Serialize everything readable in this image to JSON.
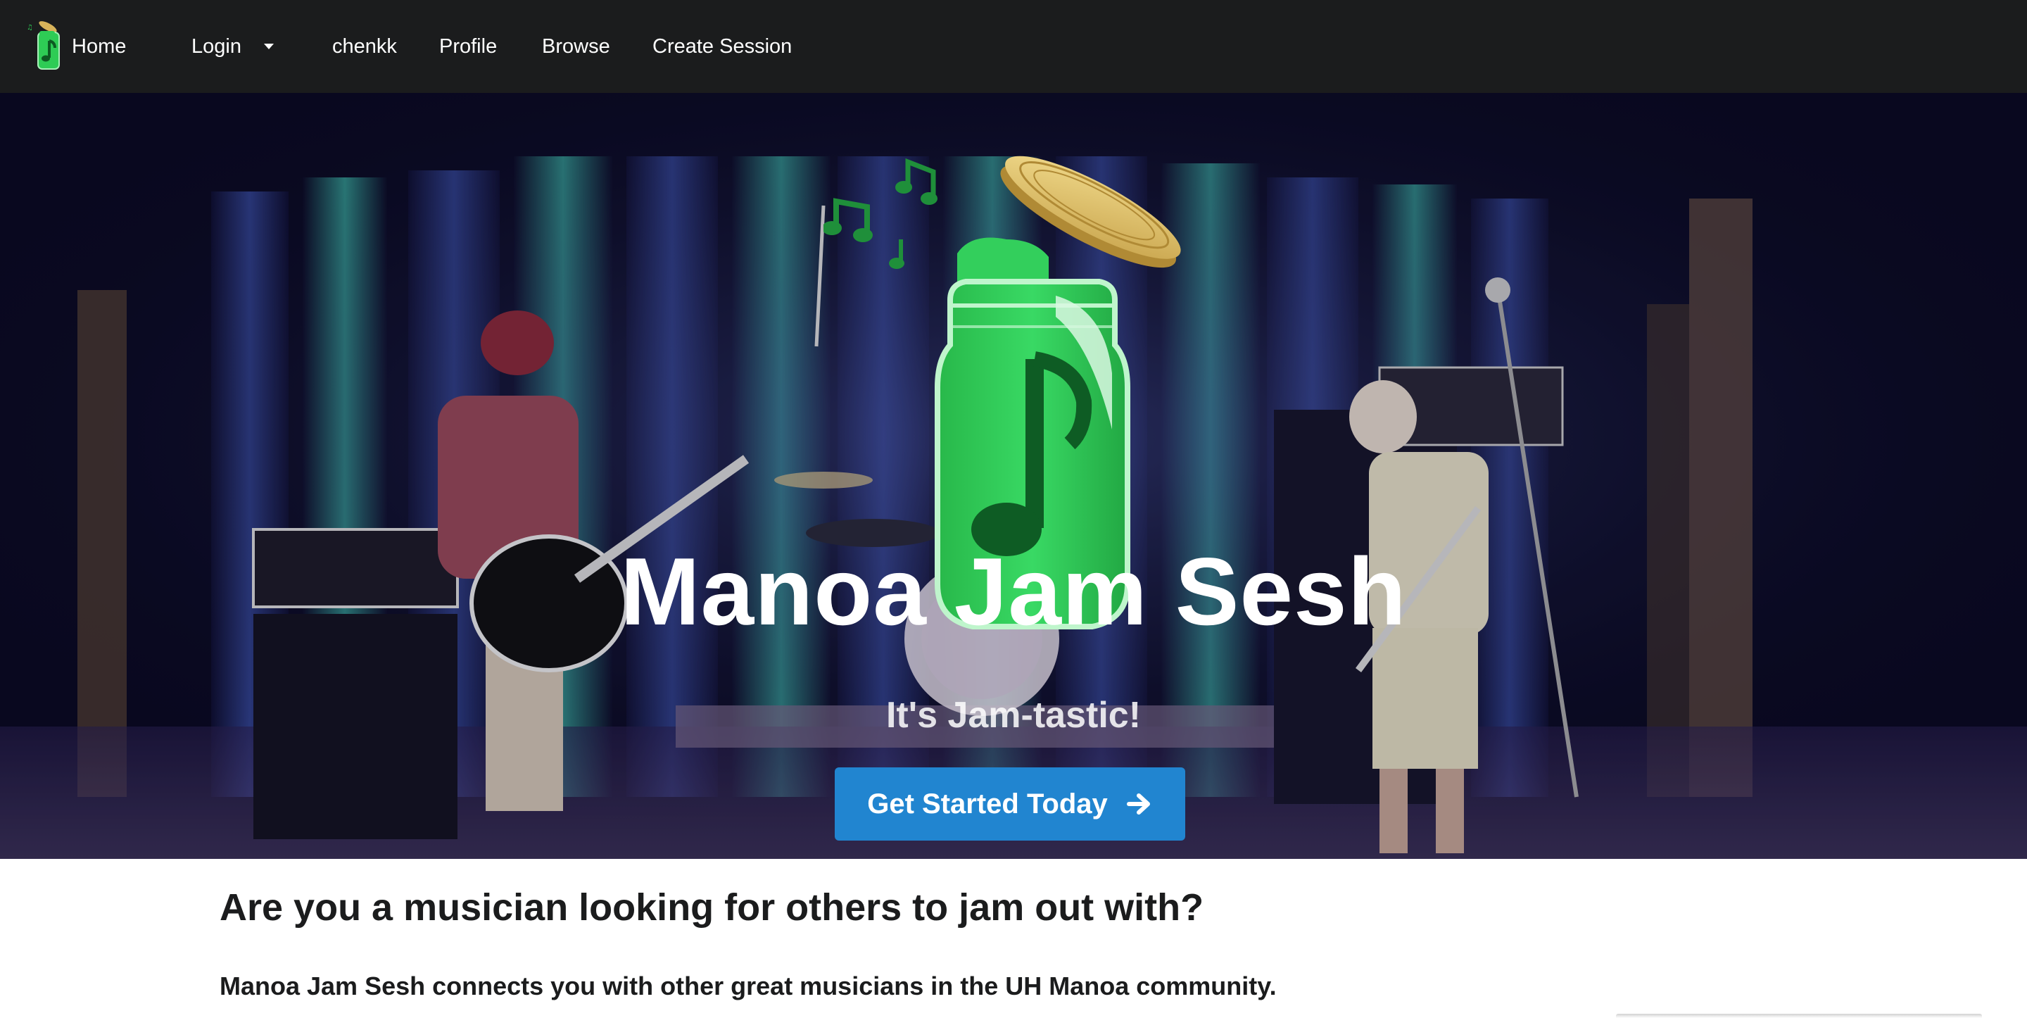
{
  "nav": {
    "home_label": "Home",
    "login_label": "Login",
    "user_label": "chenkk",
    "profile_label": "Profile",
    "browse_label": "Browse",
    "create_session_label": "Create Session",
    "logo_icon": "music-jar-icon"
  },
  "hero": {
    "title": "Manoa Jam Sesh",
    "subtitle": "It's Jam-tastic!",
    "cta_label": "Get Started Today",
    "cta_icon": "arrow-right-icon",
    "logo_icon": "music-jar-icon",
    "background": "band-on-stage-photo"
  },
  "content": {
    "heading": "Are you a musician looking for others to jam out with?",
    "text": "Manoa Jam Sesh connects you with other great musicians in the UH Manoa community."
  },
  "colors": {
    "navbar": "#1b1c1d",
    "cta": "#2185d0",
    "jar_green": "#2ecc55",
    "text_dark": "#1b1c1d"
  }
}
